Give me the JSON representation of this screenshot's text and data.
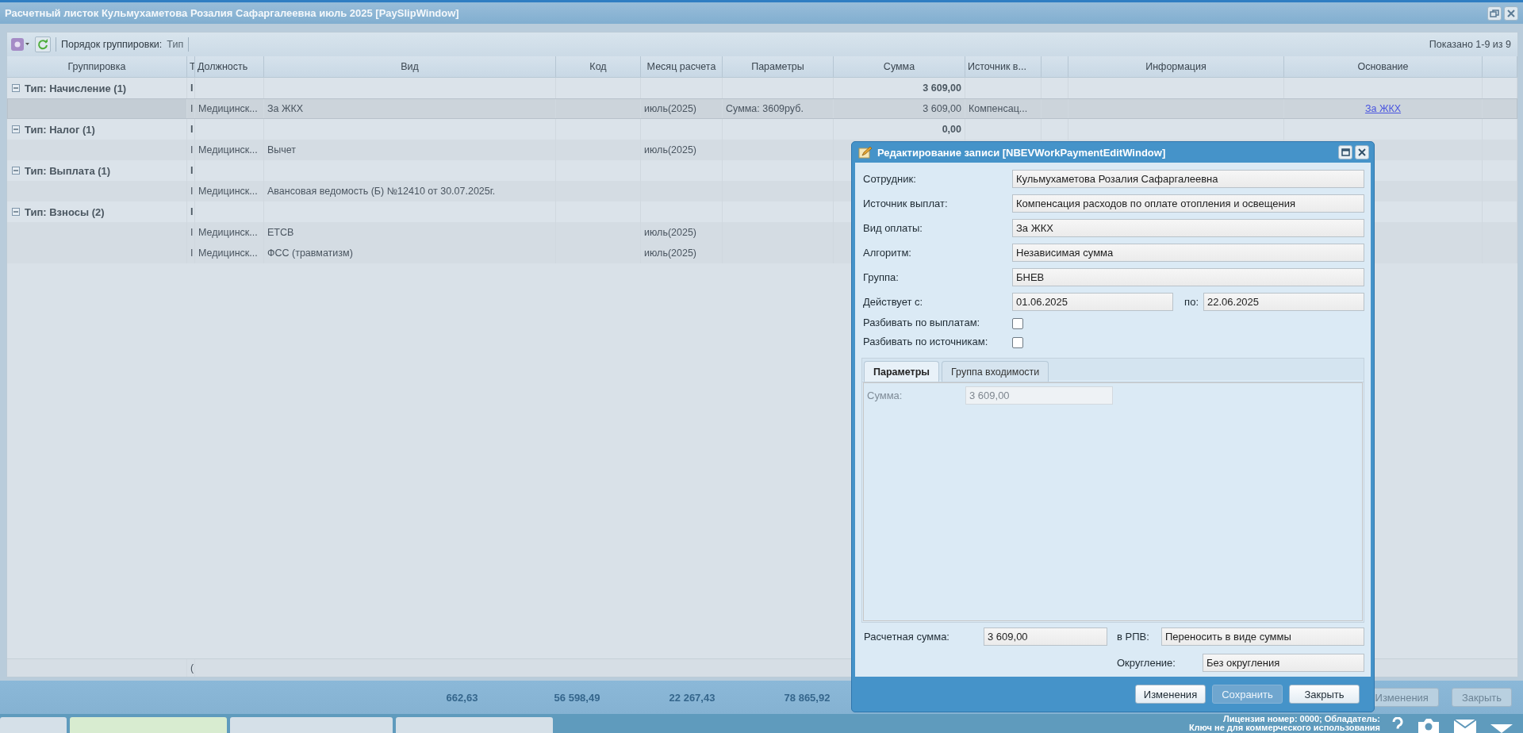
{
  "window": {
    "title": "Расчетный листок Кульмухаметова Розалия Сафаргалеевна июль 2025 [PaySlipWindow]"
  },
  "toolbar": {
    "grouping_label": "Порядок группировки:",
    "grouping_value": "Тип",
    "paging": "Показано 1-9 из 9"
  },
  "grid": {
    "columns": [
      {
        "label": "Группировка"
      },
      {
        "label": "Т"
      },
      {
        "label": "Должность"
      },
      {
        "label": "Вид"
      },
      {
        "label": "Код"
      },
      {
        "label": "Месяц расчета"
      },
      {
        "label": "Параметры"
      },
      {
        "label": "Сумма"
      },
      {
        "label": "Источник в..."
      },
      {},
      {
        "label": "Информация"
      },
      {
        "label": "Основание",
        "kind": "link"
      }
    ],
    "rows": [
      {
        "kind": "group",
        "expanded": true,
        "label": "Тип: Начисление (1)",
        "marker": "I",
        "sum": "3 609,00"
      },
      {
        "kind": "item",
        "selected": true,
        "marker": "I",
        "position": "Медицинск...",
        "type": "За ЖКХ",
        "month": "июль(2025)",
        "params": "Сумма: 3609руб.",
        "sum": "3 609,00",
        "source": "Компенсац...",
        "basis": "За ЖКХ"
      },
      {
        "kind": "group",
        "expanded": true,
        "label": "Тип: Налог (1)",
        "marker": "I",
        "sum": "0,00"
      },
      {
        "kind": "item",
        "selected": false,
        "marker": "I",
        "position": "Медицинск...",
        "type": "Вычет",
        "month": "июль(2025)"
      },
      {
        "kind": "group",
        "expanded": true,
        "label": "Тип: Выплата (1)",
        "marker": "I"
      },
      {
        "kind": "item",
        "selected": false,
        "marker": "I",
        "position": "Медицинск...",
        "type": "Авансовая ведомость (Б) №12410 от 30.07.2025г."
      },
      {
        "kind": "group",
        "expanded": true,
        "label": "Тип: Взносы (2)",
        "marker": "I"
      },
      {
        "kind": "item",
        "selected": false,
        "marker": "I",
        "position": "Медицинск...",
        "type": "ЕТСВ",
        "month": "июль(2025)"
      },
      {
        "kind": "item",
        "selected": false,
        "marker": "I",
        "position": "Медицинск...",
        "type": "ФСС (травматизм)",
        "month": "июль(2025)"
      }
    ],
    "summary_marker": "(",
    "totals": [
      "662,63",
      "56 598,49",
      "22 267,43",
      "78 865,92"
    ]
  },
  "buttons": [
    {
      "label": "Изменения"
    },
    {
      "label": "Закрыть"
    }
  ],
  "dialog": {
    "title": "Редактирование записи [NBEVWorkPaymentEditWindow]",
    "fields": [
      {
        "kind": "text",
        "label": "Сотрудник:",
        "value": "Кульмухаметова Розалия Сафаргалеевна"
      },
      {
        "kind": "text",
        "label": "Источник выплат:",
        "value": "Компенсация расходов по оплате отопления и освещения"
      },
      {
        "kind": "text",
        "label": "Вид оплаты:",
        "value": "За ЖКХ"
      },
      {
        "kind": "text",
        "label": "Алгоритм:",
        "value": "Независимая сумма"
      },
      {
        "kind": "text",
        "label": "Группа:",
        "value": "БНЕВ"
      },
      {
        "kind": "range",
        "label": "Действует с:",
        "value": "01.06.2025",
        "to_label": "по:",
        "to_value": "22.06.2025"
      },
      {
        "kind": "checkbox",
        "label": "Разбивать по выплатам:",
        "checked": false
      },
      {
        "kind": "checkbox",
        "label": "Разбивать по источникам:",
        "checked": false
      }
    ],
    "tabs": [
      {
        "label": "Параметры",
        "selected": true
      },
      {
        "label": "Группа входимости",
        "selected": false
      }
    ],
    "params": [
      {
        "label": "Сумма:",
        "value": "3 609,00",
        "disabled": true
      }
    ],
    "calc": {
      "label": "Расчетная сумма:",
      "value": "3 609,00"
    },
    "rpv": {
      "label": "в РПВ:",
      "value": "Переносить в виде суммы"
    },
    "rounding": {
      "label": "Округление:",
      "value": "Без округления"
    },
    "buttons": [
      {
        "label": "Изменения",
        "disabled": false
      },
      {
        "label": "Сохранить",
        "disabled": true
      },
      {
        "label": "Закрыть",
        "disabled": false
      }
    ]
  },
  "status": {
    "license": "Лицензия номер: 0000; Обладатель:",
    "key": "Ключ не для коммерческого использования"
  }
}
